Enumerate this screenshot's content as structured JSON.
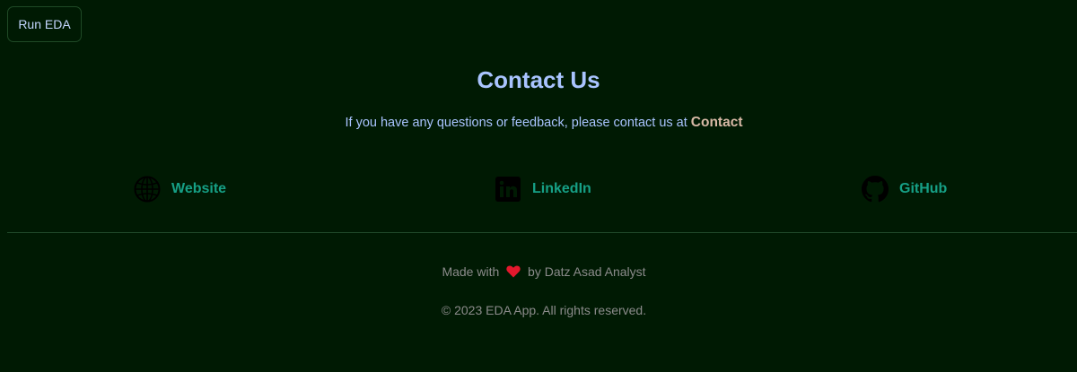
{
  "toolbar": {
    "run_label": "Run EDA"
  },
  "contact": {
    "title": "Contact Us",
    "text": "If you have any questions or feedback, please contact us at",
    "link_label": "Contact"
  },
  "social": {
    "website": {
      "label": "Website",
      "icon": "globe-icon"
    },
    "linkedin": {
      "label": "LinkedIn",
      "icon": "linkedin-icon"
    },
    "github": {
      "label": "GitHub",
      "icon": "github-icon"
    }
  },
  "footer": {
    "made_with_prefix": "Made with",
    "made_with_suffix": "by Datz Asad Analyst",
    "copyright": "© 2023 EDA App. All rights reserved."
  },
  "colors": {
    "background": "#001a03",
    "heading": "#a9c4ff",
    "link_accent": "#16a086",
    "contact_link": "#d8b9a6",
    "muted_text": "#8b8b8b",
    "heart": "#e3182d"
  }
}
